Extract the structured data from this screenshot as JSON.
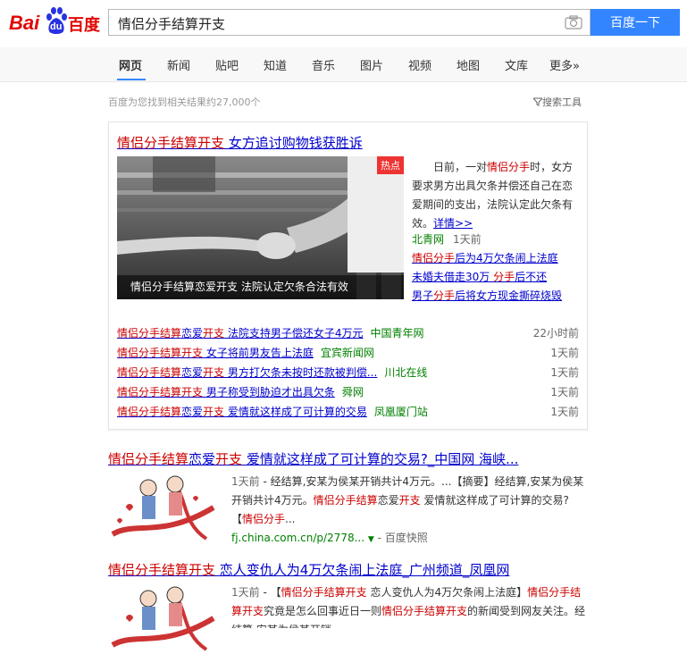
{
  "logo": {
    "text_bai": "Bai",
    "text_du": "du",
    "text_cn": "百度"
  },
  "search": {
    "query": "情侣分手结算开支",
    "button_label": "百度一下"
  },
  "nav": {
    "items": [
      "网页",
      "新闻",
      "贴吧",
      "知道",
      "音乐",
      "图片",
      "视频",
      "地图",
      "文库",
      "更多»"
    ]
  },
  "results_info": {
    "stats": "百度为您找到相关结果约27,000个",
    "tools_label": "搜索工具"
  },
  "top_card": {
    "title_hl": "情侣分手结算开支",
    "title_rest": " 女方追讨购物钱获胜诉",
    "badge": "热点",
    "image_caption": "情侣分手结算恋爱开支 法院认定欠条合法有效",
    "summary_pre": "日前，一对",
    "summary_hl": "情侣分手",
    "summary_post": "时，女方要求男方出具欠条并偿还自己在恋爱期间的支出，法院认定此欠条有效。",
    "summary_more": "详情>>",
    "source": "北青网",
    "source_time": "1天前",
    "side_links": [
      {
        "hl": "情侣分手",
        "rest": "后为4万欠条闹上法庭"
      },
      {
        "plain": "未婚夫借走30万 ",
        "hl": "分手",
        "rest": "后不还"
      },
      {
        "plain": "男子",
        "hl": "分手",
        "rest": "后将女方现金撕碎烧毁"
      }
    ],
    "news": [
      {
        "hl1": "情侣分手结算",
        "mid": "恋爱",
        "hl2": "开支",
        "rest": " 法院支持男子偿还女子4万元",
        "source": "中国青年网",
        "time": "22小时前"
      },
      {
        "hl1": "情侣分手结算开支",
        "mid": "",
        "hl2": "",
        "rest": " 女子将前男友告上法庭",
        "source": "宜宾新闻网",
        "time": "1天前"
      },
      {
        "hl1": "情侣分手结算",
        "mid": "恋爱",
        "hl2": "开支",
        "rest": " 男方打欠条未按时还款被判偿...",
        "source": "川北在线",
        "time": "1天前"
      },
      {
        "hl1": "情侣分手结算开支",
        "mid": "",
        "hl2": "",
        "rest": " 男子称受到胁迫才出具欠条",
        "source": "舜网",
        "time": "1天前"
      },
      {
        "hl1": "情侣分手结算",
        "mid": "恋爱",
        "hl2": "开支",
        "rest": " 爱情就这样成了可计算的交易",
        "source": "凤凰厦门站",
        "time": "1天前"
      }
    ]
  },
  "result1": {
    "title_hl1": "情侣分手结算",
    "title_mid": "恋爱",
    "title_hl2": "开支",
    "title_rest": " 爱情就这样成了可计算的交易?_中国网 海峡...",
    "time": "1天前",
    "body_a": " - 经结算,安某为侯某开销共计4万元。...【摘要】经结算,安某为侯某开销共计4万元。",
    "body_hl1": "情侣分手结算",
    "body_b": "恋爱",
    "body_hl2": "开支",
    "body_c": " 爱情就这样成了可计算的交易?【",
    "body_hl3": "情侣分手",
    "body_d": "...",
    "url": "fj.china.com.cn/p/2778...",
    "snapshot": "百度快照"
  },
  "result2": {
    "title_hl": "情侣分手结算开支",
    "title_rest": " 恋人变仇人为4万欠条闹上法庭_广州频道_凤凰网",
    "time": "1天前",
    "body_a": " - 【",
    "body_hl1": "情侣分手结算开支",
    "body_b": " 恋人变仇人为4万欠条闹上法庭】",
    "body_hl2": "情侣分手结算开支",
    "body_c": "究竟是怎么回事近日一则",
    "body_hl3": "情侣分手结算开支",
    "body_d": "的新闻受到网友关注。经结算,安某为侯某开销"
  }
}
